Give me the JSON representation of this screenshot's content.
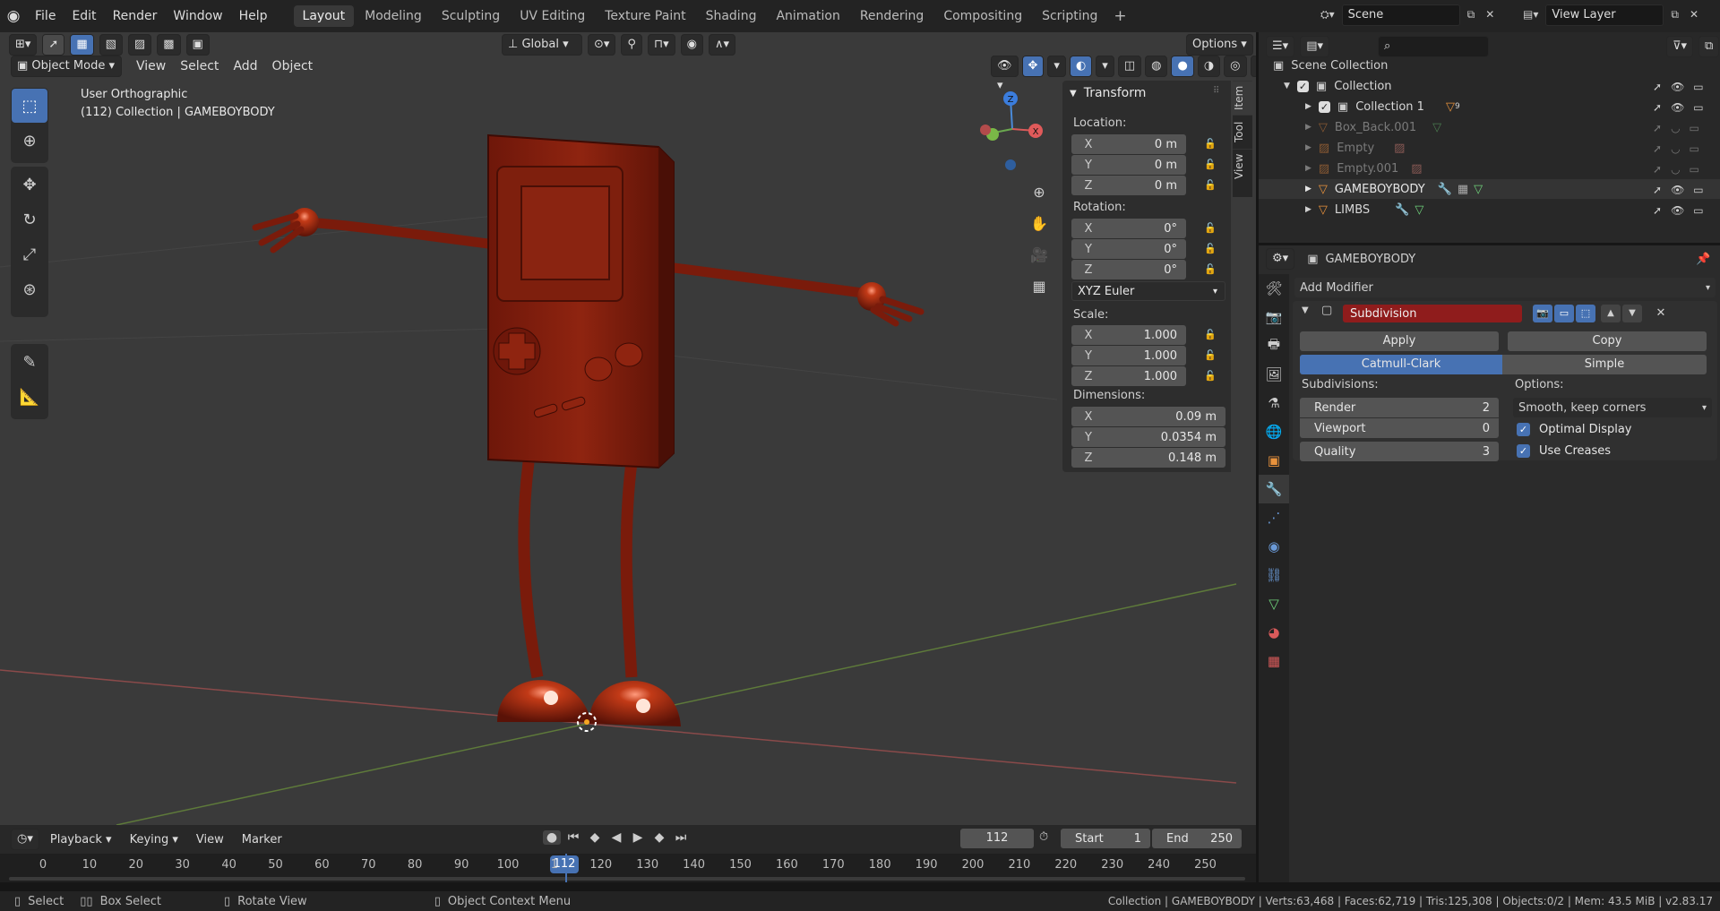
{
  "topbar": {
    "menus": [
      "File",
      "Edit",
      "Render",
      "Window",
      "Help"
    ],
    "workspaces": [
      "Layout",
      "Modeling",
      "Sculpting",
      "UV Editing",
      "Texture Paint",
      "Shading",
      "Animation",
      "Rendering",
      "Compositing",
      "Scripting"
    ],
    "active_workspace": "Layout",
    "scene": "Scene",
    "view_layer": "View Layer"
  },
  "viewport": {
    "orientation": "Global",
    "options_label": "Options",
    "mode": "Object Mode",
    "menus": [
      "View",
      "Select",
      "Add",
      "Object"
    ],
    "view_name": "User Orthographic",
    "context": "(112) Collection | GAMEBOYBODY"
  },
  "npanel": {
    "tabs": [
      "Item",
      "Tool",
      "View"
    ],
    "title": "Transform",
    "location_label": "Location:",
    "location": [
      {
        "axis": "X",
        "value": "0 m"
      },
      {
        "axis": "Y",
        "value": "0 m"
      },
      {
        "axis": "Z",
        "value": "0 m"
      }
    ],
    "rotation_label": "Rotation:",
    "rotation": [
      {
        "axis": "X",
        "value": "0°"
      },
      {
        "axis": "Y",
        "value": "0°"
      },
      {
        "axis": "Z",
        "value": "0°"
      }
    ],
    "rotation_mode": "XYZ Euler",
    "scale_label": "Scale:",
    "scale": [
      {
        "axis": "X",
        "value": "1.000"
      },
      {
        "axis": "Y",
        "value": "1.000"
      },
      {
        "axis": "Z",
        "value": "1.000"
      }
    ],
    "dimensions_label": "Dimensions:",
    "dimensions": [
      {
        "axis": "X",
        "value": "0.09 m"
      },
      {
        "axis": "Y",
        "value": "0.0354 m"
      },
      {
        "axis": "Z",
        "value": "0.148 m"
      }
    ]
  },
  "outliner": {
    "root": "Scene Collection",
    "rows": [
      {
        "label": "Collection",
        "color": "#d8d8d8"
      },
      {
        "label": "Collection 1",
        "color": "#d8d8d8",
        "badge": "9"
      },
      {
        "label": "Box_Back.001",
        "color": "#7a7a7a"
      },
      {
        "label": "Empty",
        "color": "#7a7a7a"
      },
      {
        "label": "Empty.001",
        "color": "#7a7a7a"
      },
      {
        "label": "GAMEBOYBODY",
        "color": "#e6e6e6"
      },
      {
        "label": "LIMBS",
        "color": "#d8d8d8"
      }
    ]
  },
  "properties": {
    "object_name": "GAMEBOYBODY",
    "add_modifier": "Add Modifier",
    "modifier_name": "Subdivision",
    "apply_label": "Apply",
    "copy_label": "Copy",
    "catmull_label": "Catmull-Clark",
    "simple_label": "Simple",
    "subdivisions_label": "Subdivisions:",
    "render_label": "Render",
    "render_value": "2",
    "viewport_label": "Viewport",
    "viewport_value": "0",
    "quality_label": "Quality",
    "quality_value": "3",
    "options_label": "Options:",
    "uv_smooth": "Smooth, keep corners",
    "optimal_display": "Optimal Display",
    "use_creases": "Use Creases"
  },
  "timeline": {
    "menus": [
      "Playback",
      "Keying",
      "View",
      "Marker"
    ],
    "current_frame": "112",
    "start_label": "Start",
    "start": "1",
    "end_label": "End",
    "end": "250",
    "ticks": [
      "0",
      "10",
      "20",
      "30",
      "40",
      "50",
      "60",
      "70",
      "80",
      "90",
      "100",
      "1",
      "120",
      "130",
      "140",
      "150",
      "160",
      "170",
      "180",
      "190",
      "200",
      "210",
      "220",
      "230",
      "240",
      "250"
    ]
  },
  "status": {
    "select": "Select",
    "box_select": "Box Select",
    "rotate_view": "Rotate View",
    "context_menu": "Object Context Menu",
    "stats": "Collection | GAMEBOYBODY | Verts:63,468 | Faces:62,719 | Tris:125,308 | Objects:0/2 | Mem: 43.5 MiB | v2.83.17"
  },
  "colors": {
    "accent": "#4772b3",
    "modifier_red": "#8f1c1c",
    "object_orange": "#e8923c",
    "mesh_green": "#6fd17a"
  }
}
